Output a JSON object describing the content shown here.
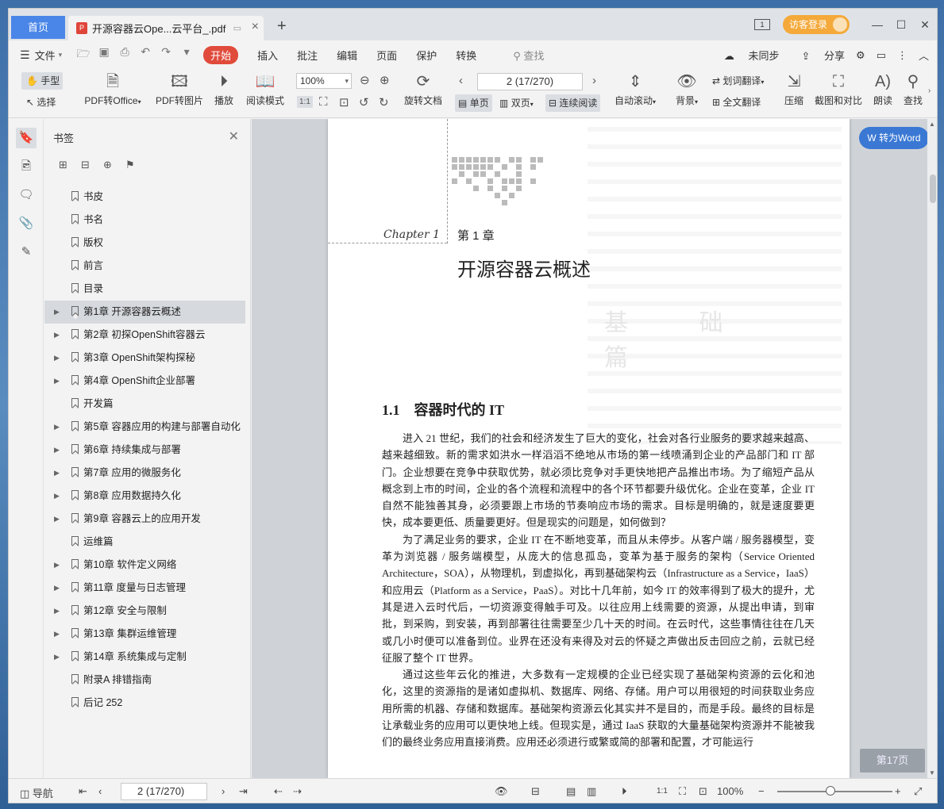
{
  "tabs": {
    "home": "首页",
    "doc_title": "开源容器云Ope...云平台_.pdf",
    "new_tab": "+"
  },
  "titlebar": {
    "window_count": "1",
    "guest_login": "访客登录"
  },
  "menu": {
    "file": "文件",
    "start": "开始",
    "items": [
      "插入",
      "批注",
      "编辑",
      "页面",
      "保护",
      "转换"
    ],
    "search": "查找",
    "unsynced": "未同步",
    "share": "分享"
  },
  "ribbon": {
    "hand": "手型",
    "select": "选择",
    "pdf_to_office": "PDF转Office",
    "pdf_to_image": "PDF转图片",
    "play": "播放",
    "read_mode": "阅读模式",
    "zoom": "100%",
    "rotate": "旋转文档",
    "page_indicator": "2 (17/270)",
    "single_page": "单页",
    "double_page": "双页",
    "continuous": "连续阅读",
    "auto_scroll": "自动滚动",
    "background": "背景",
    "word_translate": "划词翻译",
    "full_translate": "全文翻译",
    "compress": "压缩",
    "screenshot_compare": "截图和对比",
    "read_aloud": "朗读",
    "find": "查找"
  },
  "bookmarks": {
    "title": "书签",
    "items": [
      {
        "label": "书皮",
        "expandable": false
      },
      {
        "label": "书名",
        "expandable": false
      },
      {
        "label": "版权",
        "expandable": false
      },
      {
        "label": "前言",
        "expandable": false
      },
      {
        "label": "目录",
        "expandable": false
      },
      {
        "label": "第1章 开源容器云概述",
        "expandable": true,
        "selected": true
      },
      {
        "label": "第2章 初探OpenShift容器云",
        "expandable": true
      },
      {
        "label": "第3章 OpenShift架构探秘",
        "expandable": true
      },
      {
        "label": "第4章 OpenShift企业部署",
        "expandable": true
      },
      {
        "label": "开发篇",
        "expandable": false
      },
      {
        "label": "第5章 容器应用的构建与部署自动化",
        "expandable": true
      },
      {
        "label": "第6章 持续集成与部署",
        "expandable": true
      },
      {
        "label": "第7章 应用的微服务化",
        "expandable": true
      },
      {
        "label": "第8章 应用数据持久化",
        "expandable": true
      },
      {
        "label": "第9章 容器云上的应用开发",
        "expandable": true
      },
      {
        "label": "运维篇",
        "expandable": false
      },
      {
        "label": "第10章 软件定义网络",
        "expandable": true
      },
      {
        "label": "第11章 度量与日志管理",
        "expandable": true
      },
      {
        "label": "第12章 安全与限制",
        "expandable": true
      },
      {
        "label": "第13章 集群运维管理",
        "expandable": true
      },
      {
        "label": "第14章 系统集成与定制",
        "expandable": true
      },
      {
        "label": "附录A 排错指南",
        "expandable": false
      },
      {
        "label": "后记 252",
        "expandable": false
      }
    ]
  },
  "document": {
    "chapter_script": "Chapter 1",
    "chapter_no": "第 1 章",
    "chapter_title": "开源容器云概述",
    "ghost_title": "基 础 篇",
    "section_heading": "1.1　容器时代的 IT",
    "paragraphs": [
      "进入 21 世纪，我们的社会和经济发生了巨大的变化，社会对各行业服务的要求越来越高、越来越细致。新的需求如洪水一样滔滔不绝地从市场的第一线喷涌到企业的产品部门和 IT 部门。企业想要在竞争中获取优势，就必须比竞争对手更快地把产品推出市场。为了缩短产品从概念到上市的时间，企业的各个流程和流程中的各个环节都要升级优化。企业在变革，企业 IT 自然不能独善其身，必须要跟上市场的节奏响应市场的需求。目标是明确的，就是速度要更快，成本要更低、质量要更好。但是现实的问题是，如何做到？",
      "为了满足业务的要求，企业 IT 在不断地变革，而且从未停步。从客户端 / 服务器模型，变革为浏览器 / 服务端模型，从庞大的信息孤岛，变革为基于服务的架构（Service Oriented Architecture，SOA），从物理机，到虚拟化，再到基础架构云（Infrastructure as a Service，IaaS）和应用云（Platform as a Service，PaaS）。对比十几年前，如今 IT 的效率得到了极大的提升，尤其是进入云时代后，一切资源变得触手可及。以往应用上线需要的资源，从提出申请，到审批，到采购，到安装，再到部署往往需要至少几十天的时间。在云时代，这些事情往往在几天或几小时便可以准备到位。业界在还没有来得及对云的怀疑之声做出反击回应之前，云就已经征服了整个 IT 世界。",
      "通过这些年云化的推进，大多数有一定规模的企业已经实现了基础架构资源的云化和池化，这里的资源指的是诸如虚拟机、数据库、网络、存储。用户可以用很短的时间获取业务应用所需的机器、存储和数据库。基础架构资源云化其实并不是目的，而是手段。最终的目标是让承载业务的应用可以更快地上线。但现实是，通过 IaaS 获取的大量基础架构资源并不能被我们的最终业务应用直接消费。应用还必须进行或繁或简的部署和配置，才可能运行"
    ],
    "to_word": "转为Word",
    "page_badge": "第17页"
  },
  "statusbar": {
    "nav": "导航",
    "page_indicator": "2 (17/270)",
    "zoom": "100%"
  },
  "colors": {
    "accent": "#4a86e8",
    "start_red": "#e04b3b",
    "guest_orange": "#f4a93a",
    "convert_blue": "#3a78d4"
  }
}
